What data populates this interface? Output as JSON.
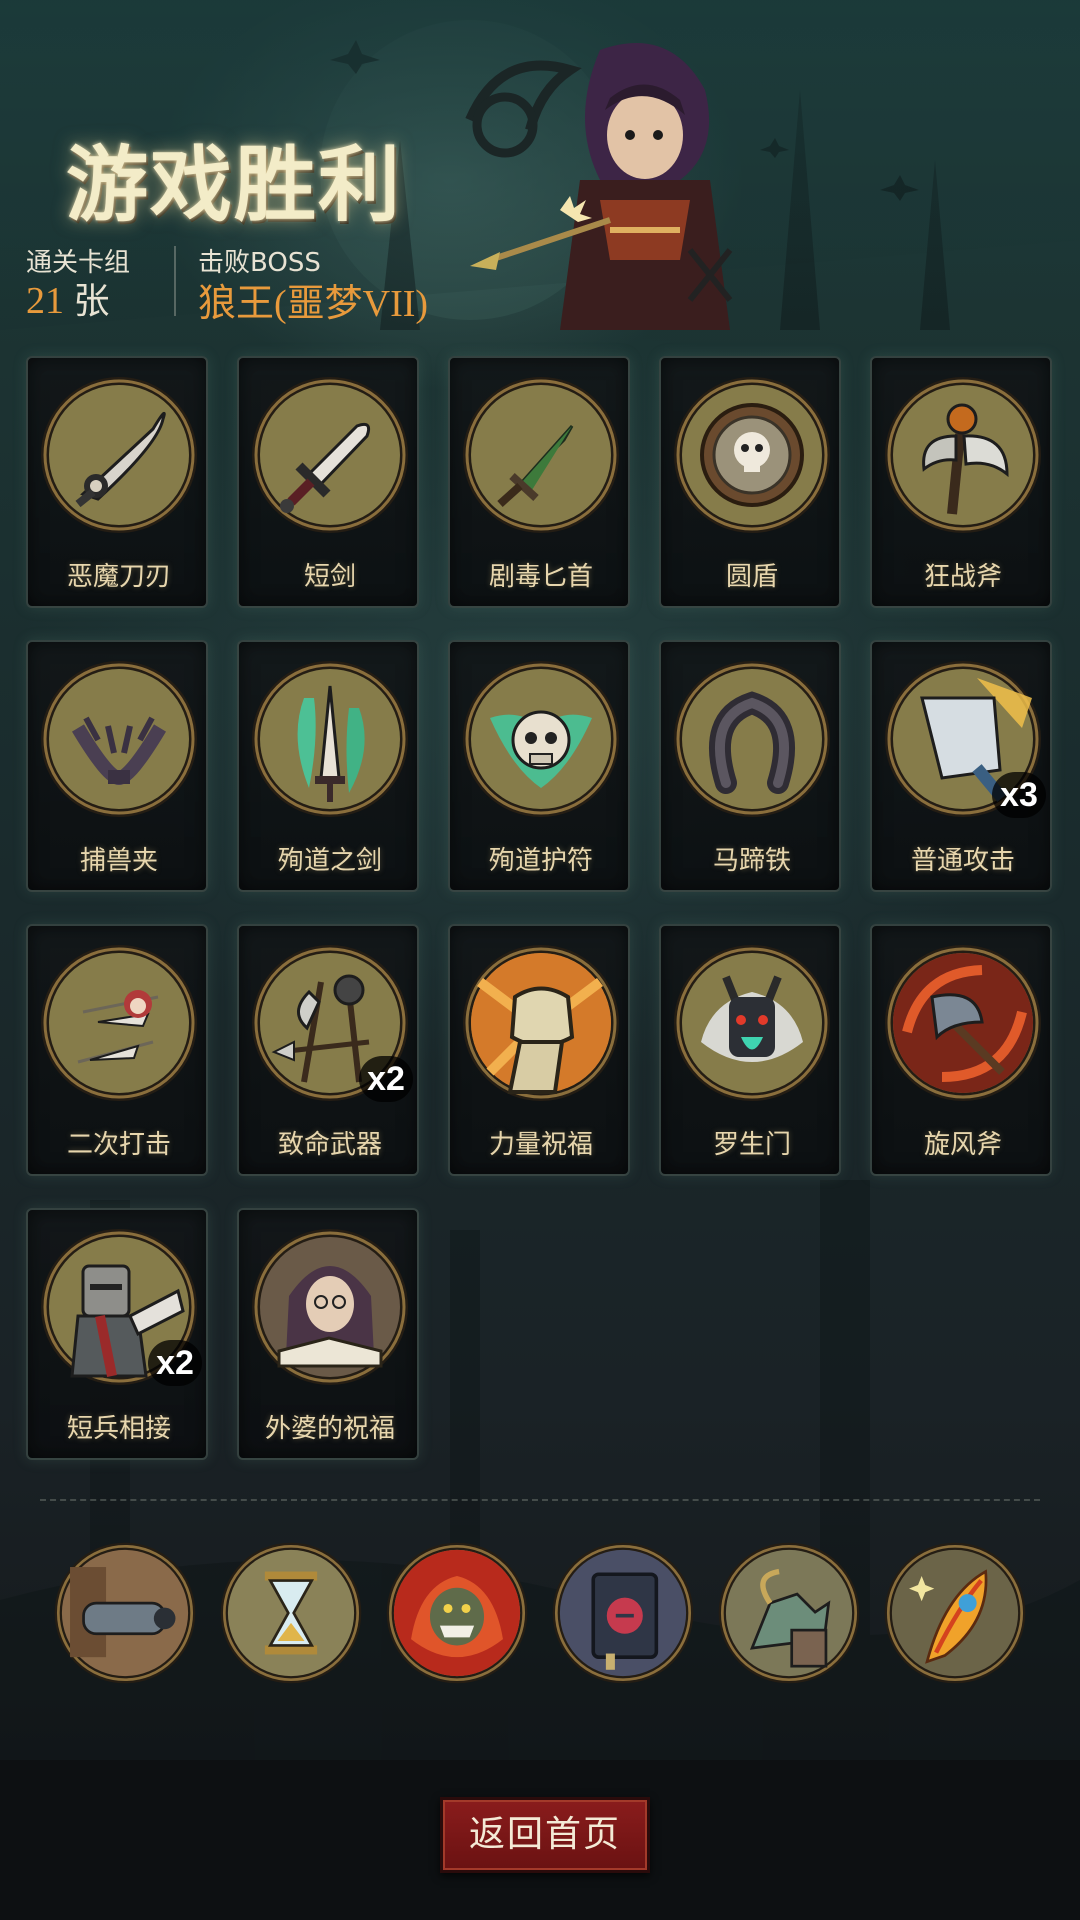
{
  "title": "游戏胜利",
  "stats": {
    "deck_label": "通关卡组",
    "deck_count": "21",
    "deck_unit": "张",
    "boss_label": "击败BOSS",
    "boss_name": "狼王(噩梦VII)"
  },
  "cards": [
    {
      "name": "恶魔刀刃",
      "icon": "demon-blade-icon",
      "count": ""
    },
    {
      "name": "短剑",
      "icon": "short-sword-icon",
      "count": ""
    },
    {
      "name": "剧毒匕首",
      "icon": "poison-dagger-icon",
      "count": ""
    },
    {
      "name": "圆盾",
      "icon": "round-shield-icon",
      "count": ""
    },
    {
      "name": "狂战斧",
      "icon": "berserker-axe-icon",
      "count": ""
    },
    {
      "name": "捕兽夹",
      "icon": "bear-trap-icon",
      "count": ""
    },
    {
      "name": "殉道之剑",
      "icon": "martyr-sword-icon",
      "count": ""
    },
    {
      "name": "殉道护符",
      "icon": "martyr-amulet-icon",
      "count": ""
    },
    {
      "name": "马蹄铁",
      "icon": "horseshoe-icon",
      "count": ""
    },
    {
      "name": "普通攻击",
      "icon": "normal-attack-icon",
      "count": "x3"
    },
    {
      "name": "二次打击",
      "icon": "double-strike-icon",
      "count": ""
    },
    {
      "name": "致命武器",
      "icon": "deadly-weapons-icon",
      "count": "x2"
    },
    {
      "name": "力量祝福",
      "icon": "strength-fist-icon",
      "count": ""
    },
    {
      "name": "罗生门",
      "icon": "rashomon-demon-icon",
      "count": ""
    },
    {
      "name": "旋风斧",
      "icon": "whirlwind-axe-icon",
      "count": ""
    },
    {
      "name": "短兵相接",
      "icon": "knight-clash-icon",
      "count": "x2"
    },
    {
      "name": "外婆的祝福",
      "icon": "grandma-blessing-icon",
      "count": ""
    }
  ],
  "relics": [
    {
      "icon": "cannon-relic-icon"
    },
    {
      "icon": "hourglass-relic-icon"
    },
    {
      "icon": "fire-monster-relic-icon"
    },
    {
      "icon": "spellbook-relic-icon"
    },
    {
      "icon": "dragon-relic-icon"
    },
    {
      "icon": "phoenix-feather-relic-icon"
    }
  ],
  "home_button_label": "返回首页",
  "colors": {
    "accent_orange": "#e89a3c",
    "title": "#f3ecc8",
    "button_red": "#7a1616",
    "medallion": "#867c4a"
  }
}
